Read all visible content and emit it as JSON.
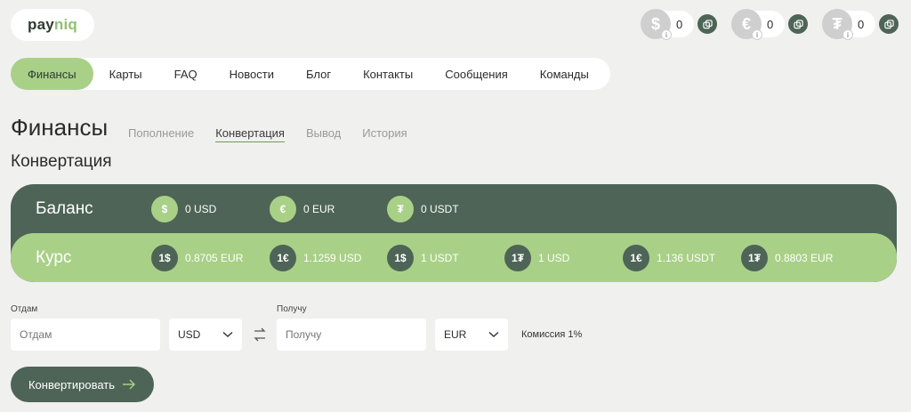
{
  "logo": {
    "part1": "pay",
    "part2": "niq"
  },
  "wallets": [
    {
      "icon": "dollar-icon",
      "symbol": "$",
      "amount": "0"
    },
    {
      "icon": "euro-icon",
      "symbol": "€",
      "amount": "0"
    },
    {
      "icon": "tether-icon",
      "symbol": "₮",
      "amount": "0"
    }
  ],
  "nav": {
    "items": [
      {
        "label": "Финансы",
        "active": true
      },
      {
        "label": "Карты"
      },
      {
        "label": "FAQ"
      },
      {
        "label": "Новости"
      },
      {
        "label": "Блог"
      },
      {
        "label": "Контакты"
      },
      {
        "label": "Сообщения"
      },
      {
        "label": "Команды"
      }
    ]
  },
  "page_title": "Финансы",
  "subtabs": [
    {
      "label": "Пополнение"
    },
    {
      "label": "Конвертация",
      "active": true
    },
    {
      "label": "Вывод"
    },
    {
      "label": "История"
    }
  ],
  "section_title": "Конвертация",
  "balance": {
    "label": "Баланс",
    "items": [
      {
        "symbol": "$",
        "text": "0 USD"
      },
      {
        "symbol": "€",
        "text": "0 EUR"
      },
      {
        "symbol": "₮",
        "text": "0 USDT"
      }
    ]
  },
  "rates": {
    "label": "Курс",
    "items": [
      {
        "symbol": "1$",
        "text": "0.8705 EUR"
      },
      {
        "symbol": "1€",
        "text": "1.1259 USD"
      },
      {
        "symbol": "1$",
        "text": "1 USDT"
      },
      {
        "symbol": "1₮",
        "text": "1 USD"
      },
      {
        "symbol": "1€",
        "text": "1.136 USDT"
      },
      {
        "symbol": "1₮",
        "text": "0.8803 EUR"
      }
    ]
  },
  "form": {
    "give_label": "Отдам",
    "give_placeholder": "Отдам",
    "give_currency": "USD",
    "get_label": "Получу",
    "get_placeholder": "Получу",
    "get_currency": "EUR",
    "fee": "Комиссия 1%",
    "submit": "Конвертировать"
  },
  "colors": {
    "dark_green": "#4e6457",
    "light_green": "#a9d087",
    "background": "#f0f0ef"
  }
}
